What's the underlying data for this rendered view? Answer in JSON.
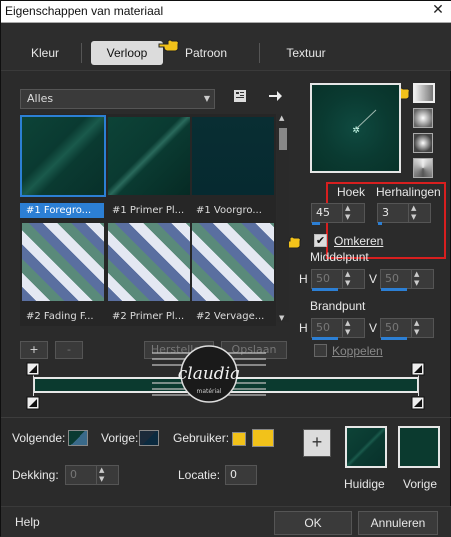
{
  "window": {
    "title": "Eigenschappen van materiaal",
    "close": "✕"
  },
  "tabs": [
    {
      "label": "Kleur"
    },
    {
      "label": "Verloop"
    },
    {
      "label": "Patroon"
    },
    {
      "label": "Textuur"
    }
  ],
  "library": {
    "filter": "Alles",
    "items": [
      {
        "label": "#1 Foregro..."
      },
      {
        "label": "#1 Primer Pl..."
      },
      {
        "label": "#1 Voorgro..."
      },
      {
        "label": "#2 Fading F..."
      },
      {
        "label": "#2 Primer Pl..."
      },
      {
        "label": "#2 Vervage..."
      }
    ]
  },
  "editor": {
    "add": "+",
    "remove": "-",
    "herstellen": "Herstellen",
    "opslaan": "Opslaan"
  },
  "angle": {
    "label": "Hoek",
    "value": "45"
  },
  "repeats": {
    "label": "Herhalingen",
    "value": "3"
  },
  "invert": {
    "label": "Omkeren",
    "checked": true
  },
  "center": {
    "label": "Middelpunt",
    "h_label": "H",
    "h_value": "50",
    "v_label": "V",
    "v_value": "50"
  },
  "focal": {
    "label": "Brandpunt",
    "h_label": "H",
    "h_value": "50",
    "v_label": "V",
    "v_value": "50"
  },
  "link": {
    "label": "Koppelen"
  },
  "stops": {
    "follow_label": "Volgende:",
    "previous_label": "Vorige:",
    "user_label": "Gebruiker:",
    "opacity_label": "Dekking:",
    "opacity_value": "0",
    "location_label": "Locatie:",
    "location_value": "0"
  },
  "swatches": {
    "add": "+",
    "current": "Huidige",
    "previous": "Vorige"
  },
  "footer": {
    "help": "Help",
    "ok": "OK",
    "cancel": "Annuleren"
  },
  "watermark": {
    "text": "claudia",
    "sub": "matérial"
  },
  "colors": {
    "gradient_dark": "#0b3a2f",
    "accent": "#2c7fd4",
    "highlight_red": "#d81f1f",
    "user_yellow": "#f2c21a"
  }
}
